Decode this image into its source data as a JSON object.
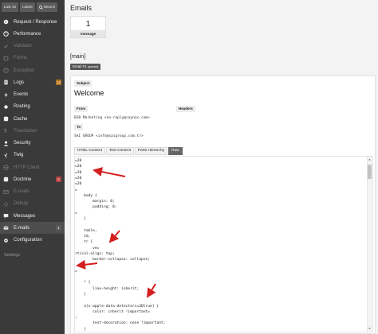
{
  "toolbar": {
    "last10": "Last 10",
    "latest": "Latest",
    "search": "Search"
  },
  "sidebar": {
    "items": [
      {
        "label": "Request / Response",
        "icon": "request-icon",
        "state": "normal"
      },
      {
        "label": "Performance",
        "icon": "performance-icon",
        "state": "normal"
      },
      {
        "label": "Validator",
        "icon": "validator-icon",
        "state": "disabled"
      },
      {
        "label": "Forms",
        "icon": "forms-icon",
        "state": "disabled"
      },
      {
        "label": "Exception",
        "icon": "exception-icon",
        "state": "disabled"
      },
      {
        "label": "Logs",
        "icon": "logs-icon",
        "state": "normal",
        "badge": "12",
        "badge_color": "#b0721a"
      },
      {
        "label": "Events",
        "icon": "events-icon",
        "state": "normal"
      },
      {
        "label": "Routing",
        "icon": "routing-icon",
        "state": "normal"
      },
      {
        "label": "Cache",
        "icon": "cache-icon",
        "state": "normal"
      },
      {
        "label": "Translation",
        "icon": "translation-icon",
        "state": "disabled"
      },
      {
        "label": "Security",
        "icon": "security-icon",
        "state": "normal"
      },
      {
        "label": "Twig",
        "icon": "twig-icon",
        "state": "normal"
      },
      {
        "label": "HTTP Client",
        "icon": "http-client-icon",
        "state": "disabled"
      },
      {
        "label": "Doctrine",
        "icon": "doctrine-icon",
        "state": "normal",
        "badge": "5",
        "badge_color": "#b0413e"
      },
      {
        "label": "E-mails",
        "icon": "emails-disabled-icon",
        "state": "disabled"
      },
      {
        "label": "Debug",
        "icon": "debug-icon",
        "state": "disabled"
      },
      {
        "label": "Messages",
        "icon": "messages-icon",
        "state": "normal"
      },
      {
        "label": "E-mails",
        "icon": "emails-icon",
        "state": "active",
        "badge": "1",
        "badge_color": "#5a5a5a"
      },
      {
        "label": "Configuration",
        "icon": "configuration-icon",
        "state": "normal"
      }
    ],
    "settings": "Settings"
  },
  "main": {
    "title": "Emails",
    "metric": {
      "value": "1",
      "label": "message"
    },
    "section_title": "[main]",
    "email_tab": {
      "label": "Email #1",
      "sub": "(queued)"
    },
    "subject_label": "Subject",
    "subject": "Welcome",
    "from_label": "From",
    "headers_label": "Headers",
    "from": "B2B Marketing <no-reply@caynac.com>",
    "to_label": "To",
    "to": "SAI GROUP <info@saigroup.com.tr>",
    "content_tabs": [
      "HTML Content",
      "Text Content",
      "Parts Hierarchy",
      "Raw"
    ],
    "active_tab": 3
  },
  "code_lines": [
    "=20",
    "=20",
    "=20",
    "=20",
    "=20",
    "=",
    "    body {",
    "        margin: 0;",
    "        padding: 0;",
    "=",
    "    }",
    "",
    "    table,",
    "    td,",
    "    tr {",
    "        ve=",
    "rtical-align: top;",
    "        border-collapse: collapse;",
    "    }",
    "=",
    "",
    "    * {",
    "        line-height: inherit;",
    "    }",
    "",
    "    a[x-apple-data-detectors=3Dtrue] {",
    "        color: inherit !important=",
    ";",
    "        text-decoration: none !important;",
    "    }"
  ],
  "colors": {
    "sidebar_bg": "#3a3a3a",
    "arrow": "#d42020"
  }
}
